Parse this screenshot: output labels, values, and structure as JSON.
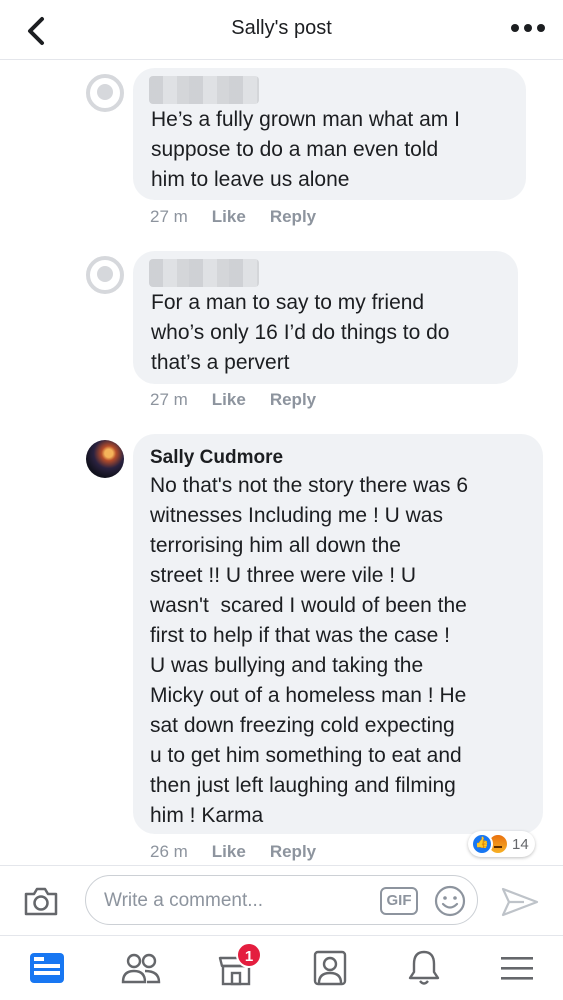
{
  "header": {
    "title": "Sally's post"
  },
  "comments": [
    {
      "author": "",
      "text": "He’s a fully grown man what am I\nsuppose to do a man even told\nhim to leave us alone",
      "time": "27 m",
      "like": "Like",
      "reply": "Reply"
    },
    {
      "author": "",
      "text": "For a man to say to my friend\nwho’s only 16 I’d do things to do\nthat’s a pervert",
      "time": "27 m",
      "like": "Like",
      "reply": "Reply"
    },
    {
      "author": "Sally Cudmore",
      "text": "No that's not the story there was 6\nwitnesses Including me ! U was\nterrorising him all down the\nstreet !! U three were vile ! U\nwasn't  scared I would of been the\nfirst to help if that was the case !\nU was bullying and taking the\nMicky out of a homeless man ! He\nsat down freezing cold expecting\nu to get him something to eat and\nthen just left laughing and filming\nhim ! Karma",
      "time": "26 m",
      "like": "Like",
      "reply": "Reply",
      "reaction_count": "14",
      "reaction_icons": [
        "like-reaction-icon",
        "angry-reaction-icon"
      ]
    }
  ],
  "composer": {
    "placeholder": "Write a comment...",
    "gif_label": "GIF"
  },
  "nav": {
    "marketplace_badge": "1",
    "icons": [
      "news-feed-icon",
      "friends-icon",
      "marketplace-icon",
      "profile-icon",
      "notifications-icon",
      "menu-icon"
    ]
  },
  "colors": {
    "accent": "#1877f2",
    "bubble": "#f0f2f5",
    "muted": "#8d949e",
    "badge": "#e41e3f"
  }
}
